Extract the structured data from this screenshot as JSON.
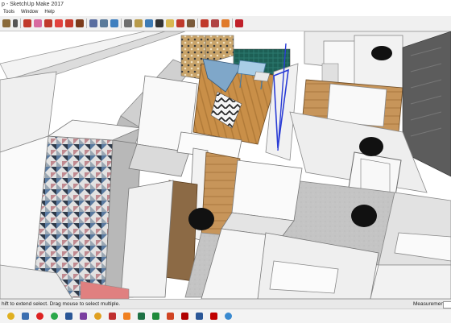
{
  "window": {
    "title": "p - SketchUp Make 2017"
  },
  "menu": [
    "Tools",
    "Window",
    "Help"
  ],
  "toolbar": {
    "tools": [
      "select-tool",
      "component-tool",
      "eraser-tool",
      "paint-tool",
      "move-tool",
      "rotate-tool",
      "scale-tool",
      "offset-tool",
      "push-pull-tool",
      "orbit-tool",
      "pan-tool",
      "zoom-tool",
      "zoom-window-tool",
      "zoom-extents-tool",
      "section-plane-tool",
      "walk-tool",
      "look-around-tool",
      "position-camera-tool",
      "add-location-tool",
      "terrain-tool",
      "sandbox-tool",
      "3d-warehouse-tool",
      "extension-warehouse-tool",
      "extension-manager-tool"
    ]
  },
  "status": {
    "hint": "hift to extend select. Drag mouse to select multiple.",
    "measurements_label": "Measurements"
  },
  "taskbar": {
    "apps": [
      "chrome",
      "file-explorer",
      "opera",
      "whatsapp",
      "word",
      "onenote",
      "chrome-2",
      "outlook",
      "vlc",
      "excel",
      "skype",
      "powerpoint",
      "acrobat",
      "word-2",
      "acrobat-2",
      "chrome-3"
    ]
  },
  "colors": {
    "toolbar_bg": "#f0f0f0",
    "status_bg": "#e9e9e9",
    "floor_wood": "#c8904a",
    "floor_tile": "#c6c6c6",
    "wall_white": "#f7f7f7",
    "wall_shade": "#d8d8d8",
    "accent_blue": "#2b3dd6",
    "teal_wall": "#1f6a5c",
    "dark_circle": "#0f0f0f"
  }
}
